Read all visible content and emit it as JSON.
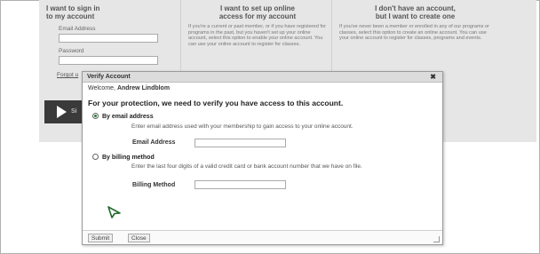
{
  "background": {
    "col1": {
      "title_line1": "I want to sign in",
      "title_line2": "to my account",
      "email_label": "Email Address",
      "password_label": "Password",
      "forgot_link": "Forgot u"
    },
    "col2": {
      "title_line1": "I want to set up online",
      "title_line2": "access for my account",
      "text": "If you're a current or past member, or if you have registered for programs in the past, but you haven't set up your online account, select this option to enable your online account. You can use your online account to register for classes."
    },
    "col3": {
      "title_line1": "I don't have an account,",
      "title_line2": "but I want to create one",
      "text": "If you've never been a member or enrolled in any of our programs or classes, select this option to create an online account. You can use your online account to register for classes, programs and events."
    },
    "signin_bar_text": "Si"
  },
  "modal": {
    "title": "Verify Account",
    "close_glyph": "✖",
    "welcome_prefix": "Welcome,",
    "welcome_name": "Andrew Lindblom",
    "headline": "For your protection, we need to verify you have access to this account.",
    "option_email": {
      "label": "By email address",
      "selected": true,
      "description": "Enter email address used with your membership to gain access to your online account.",
      "field_label": "Email Address",
      "field_value": ""
    },
    "option_billing": {
      "label": "By billing method",
      "selected": false,
      "description": "Enter the last four digits of a valid credit card or bank account number that we have on file.",
      "field_label": "Billing Method",
      "field_value": ""
    },
    "buttons": {
      "submit": "Submit",
      "close": "Close"
    }
  },
  "colors": {
    "accent_radio": "#2a7a2a",
    "cursor": "#1f6a2a"
  }
}
